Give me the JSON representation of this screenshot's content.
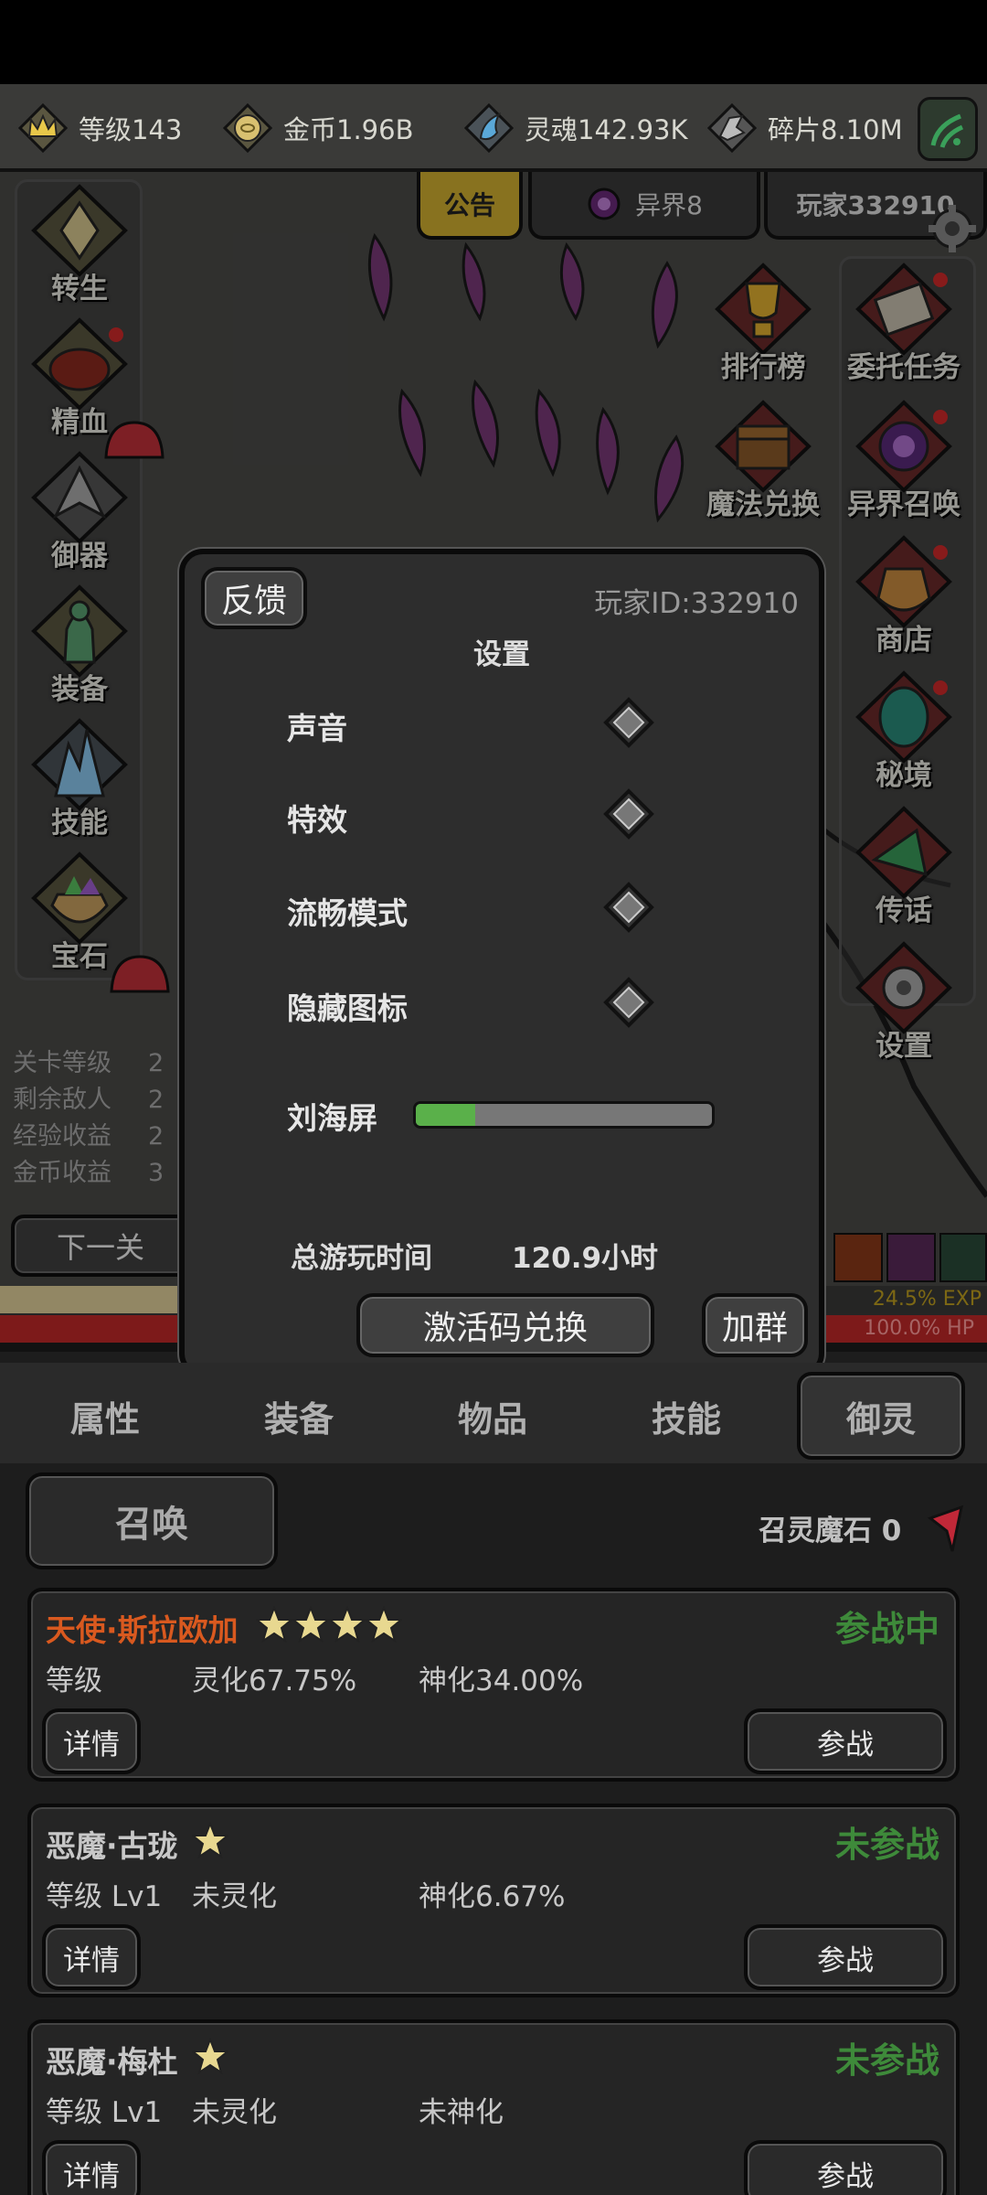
{
  "topbar": {
    "level_label": "等级143",
    "gold_label": "金币1.96B",
    "soul_label": "灵魂142.93K",
    "shard_label": "碎片8.10M"
  },
  "tabs": {
    "notice": "公告",
    "otherworld": "异界8",
    "player": "玩家332910"
  },
  "left_menu": [
    "转生",
    "精血",
    "御器",
    "装备",
    "技能",
    "宝石"
  ],
  "right_menu": [
    "排行榜",
    "委托任务",
    "魔法兑换",
    "异界召唤",
    "商店",
    "秘境",
    "传话",
    "设置"
  ],
  "stage_stats": {
    "labels": [
      "关卡等级",
      "剩余敌人",
      "经验收益",
      "金币收益"
    ],
    "values": [
      "2",
      "2",
      "2",
      "3"
    ]
  },
  "next_level_label": "下一关",
  "bars": {
    "exp_label": "24.5% EXP",
    "hp_label": "100.0%  HP",
    "exp_percent": 24.5,
    "hp_percent": 100.0
  },
  "dialog": {
    "feedback_label": "反馈",
    "player_id": "玩家ID:332910",
    "title": "设置",
    "settings": [
      "声音",
      "特效",
      "流畅模式",
      "隐藏图标"
    ],
    "notch_label": "刘海屏",
    "notch_slider_percent": 20,
    "playtime_label": "总游玩时间",
    "playtime_value": "120.9小时",
    "redeem_label": "激活码兑换",
    "join_group_label": "加群"
  },
  "bottom_tabs": [
    "属性",
    "装备",
    "物品",
    "技能",
    "御灵"
  ],
  "active_bottom_tab": "御灵",
  "summon": {
    "button_label": "召唤",
    "stone_label": "召灵魔石 0"
  },
  "spirits": [
    {
      "name": "天使·斯拉欧加",
      "name_color": "#d9591f",
      "stars": 4,
      "status": "参战中",
      "level": "等级",
      "spirit": "灵化67.75%",
      "divine": "神化34.00%",
      "detail_label": "详情",
      "fight_label": "参战"
    },
    {
      "name": "恶魔·古珑",
      "name_color": "#c8c8c8",
      "stars": 1,
      "status": "未参战",
      "level": "等级 Lv1",
      "spirit": "未灵化",
      "divine": "神化6.67%",
      "detail_label": "详情",
      "fight_label": "参战"
    },
    {
      "name": "恶魔·梅杜",
      "name_color": "#c8c8c8",
      "stars": 1,
      "status": "未参战",
      "level": "等级 Lv1",
      "spirit": "未灵化",
      "divine": "未神化",
      "detail_label": "详情",
      "fight_label": "参战"
    }
  ]
}
